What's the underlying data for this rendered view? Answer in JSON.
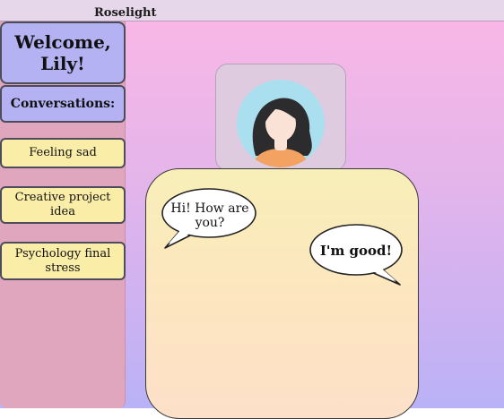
{
  "app": {
    "title": "Roselight"
  },
  "sidebar": {
    "welcome": "Welcome, Lily!",
    "conversations_header": "Conversations:",
    "conversations": [
      "Feeling sad",
      "Creative project idea",
      "Psychology final stress"
    ]
  },
  "chat": {
    "messages": [
      {
        "text": "Hi! How are you?"
      },
      {
        "text": "I'm good!"
      }
    ]
  },
  "colors": {
    "accent_purple": "#b4b2f3",
    "item_yellow": "#f9eda8",
    "sidebar_pink": "#e0a6be",
    "avatar_bg": "#a9dfee",
    "shirt": "#f4a262"
  },
  "icons": {
    "avatar": "user-avatar-icon"
  }
}
